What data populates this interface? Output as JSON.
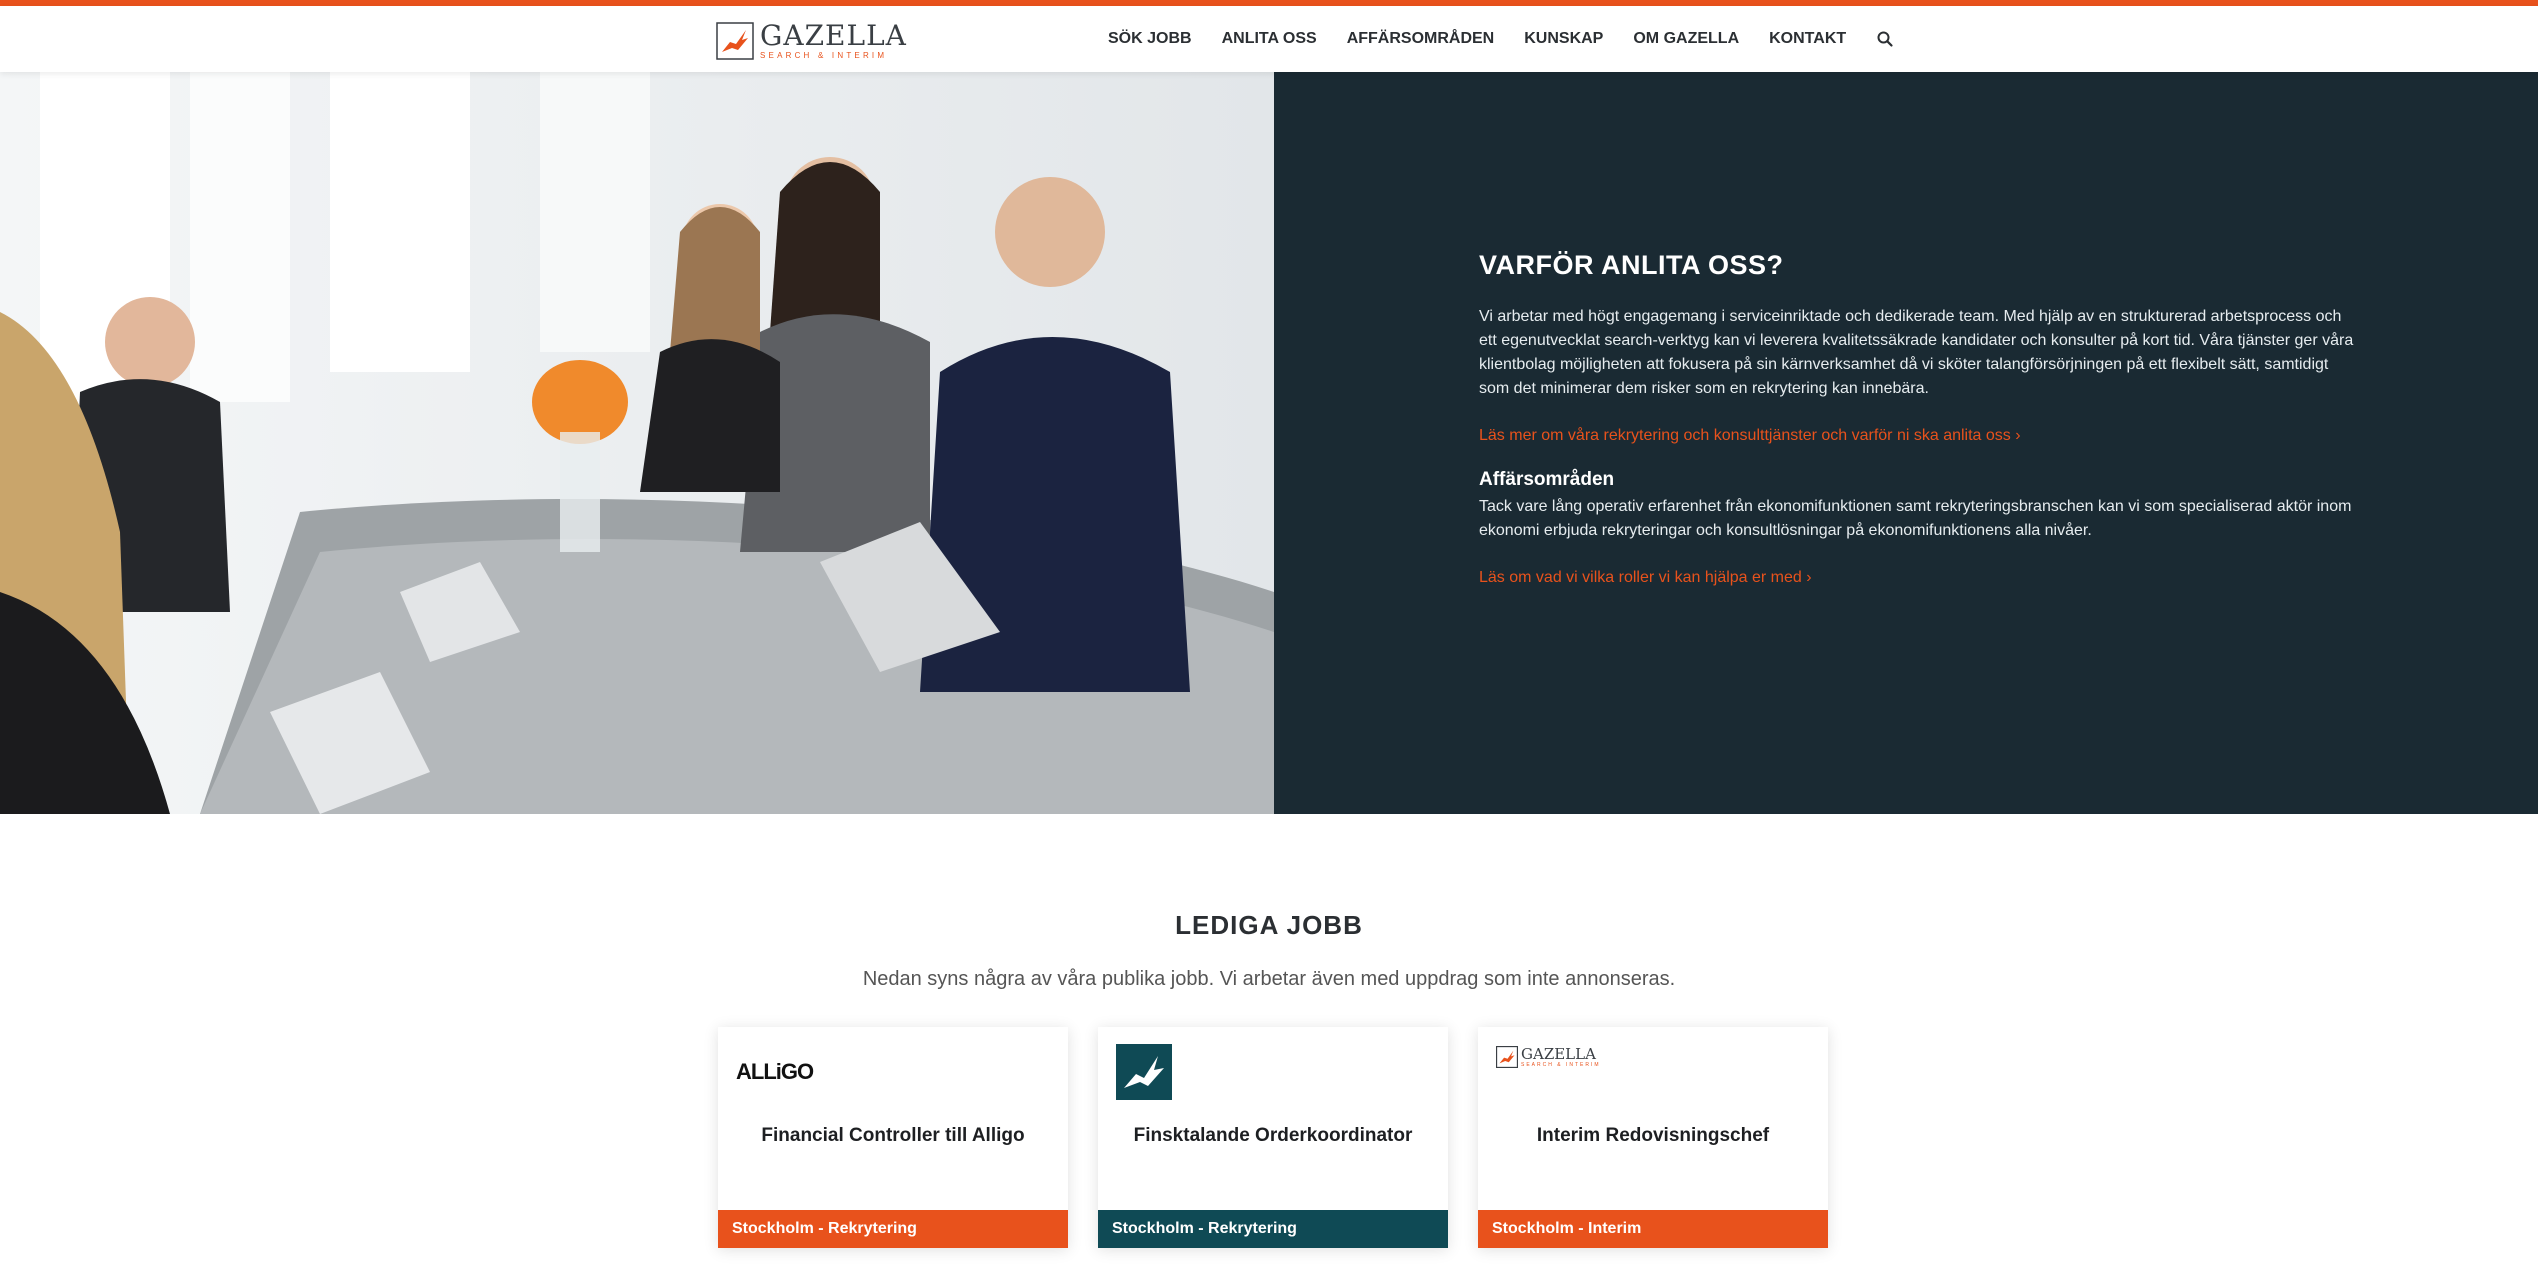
{
  "colors": {
    "accent": "#e8521c",
    "dark_panel": "#1a2a33",
    "teal": "#0f4a55"
  },
  "header": {
    "logo_name": "GAZELLA",
    "logo_sub": "SEARCH & INTERIM",
    "nav": [
      "SÖK JOBB",
      "ANLITA OSS",
      "AFFÄRSOMRÅDEN",
      "KUNSKAP",
      "OM GAZELLA",
      "KONTAKT"
    ],
    "search_icon": "search-icon"
  },
  "hero": {
    "image": "meeting-photo",
    "title": "VARFÖR ANLITA OSS?",
    "text": "Vi arbetar med högt engagemang i serviceinriktade och dedikerade team. Med hjälp av en strukturerad arbetsprocess och ett egenutvecklat search-verktyg kan vi leverera kvalitetssäkrade kandidater och konsulter på kort tid. Våra tjänster ger våra klientbolag möjligheten att fokusera på sin kärnverksamhet då vi sköter talangförsörjningen på ett flexibelt sätt, samtidigt som det minimerar dem risker som en rekrytering kan innebära.",
    "link1": "Läs mer om våra rekrytering och konsulttjänster och varför ni ska anlita oss ›",
    "subtitle": "Affärsområden",
    "text2": "Tack vare lång operativ erfarenhet från ekonomifunktionen samt rekryteringsbranschen kan vi som specialiserad aktör inom ekonomi erbjuda rekryteringar och konsultlösningar på ekonomifunktionens alla nivåer.",
    "link2": "Läs om vad vi vilka roller vi kan hjälpa er med ›"
  },
  "jobs": {
    "title": "LEDIGA JOBB",
    "subtitle": "Nedan syns några av våra publika jobb. Vi arbetar även med uppdrag som inte annonseras.",
    "cards": [
      {
        "logo": "ALLiGO",
        "title": "Financial Controller till Alligo",
        "footer": "Stockholm - Rekrytering",
        "footer_color": "#e8521c"
      },
      {
        "logo": "gazelle-mark",
        "title": "Finsktalande Orderkoordinator",
        "footer": "Stockholm - Rekrytering",
        "footer_color": "#0f4a55"
      },
      {
        "logo": "GAZELLA",
        "logo_sub": "SEARCH & INTERIM",
        "title": "Interim Redovisningschef",
        "footer": "Stockholm - Interim",
        "footer_color": "#e8521c"
      }
    ]
  }
}
